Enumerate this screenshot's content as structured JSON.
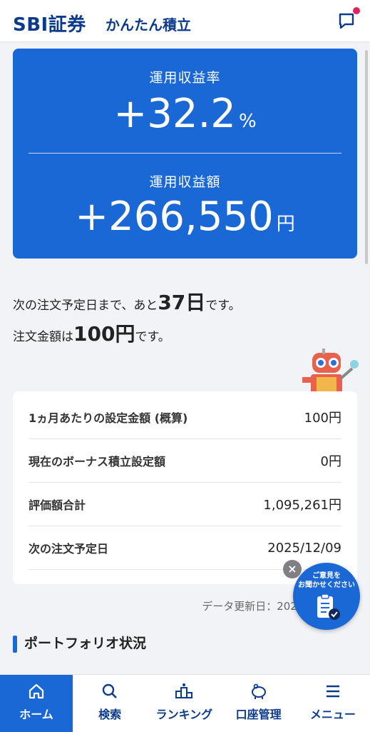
{
  "header": {
    "brand": "SBI証券",
    "app_name": "かんたん積立"
  },
  "summary": {
    "rate_label": "運用収益率",
    "rate_value": "+32.2",
    "rate_unit": "%",
    "amount_label": "運用収益額",
    "amount_value": "+266,550",
    "amount_unit": "円"
  },
  "info": {
    "line1_prefix": "次の注文予定日まで、あと",
    "days": "37日",
    "line1_suffix": "です。",
    "line2_prefix": "注文金額は",
    "amount": "100円",
    "line2_suffix": "です。"
  },
  "table": {
    "rows": [
      {
        "label": "1ヵ月あたりの設定金額 (概算)",
        "value": "100円"
      },
      {
        "label": "現在のボーナス積立設定額",
        "value": "0円"
      },
      {
        "label": "評価額合計",
        "value": "1,095,261円"
      },
      {
        "label": "次の注文予定日",
        "value": "2025/12/09"
      }
    ]
  },
  "updated": "データ更新日：2025/1",
  "feedback": {
    "line1": "ご意見を",
    "line2": "お聞かせください",
    "close": "×"
  },
  "section": {
    "title": "ポートフォリオ状況"
  },
  "nav": {
    "items": [
      {
        "label": "ホーム",
        "icon": "home-icon",
        "active": true
      },
      {
        "label": "検索",
        "icon": "search-icon",
        "active": false
      },
      {
        "label": "ランキング",
        "icon": "ranking-icon",
        "active": false
      },
      {
        "label": "口座管理",
        "icon": "piggy-bank-icon",
        "active": false
      },
      {
        "label": "メニュー",
        "icon": "menu-icon",
        "active": false
      }
    ]
  },
  "colors": {
    "primary": "#1a67d6",
    "navy": "#0c3b8c",
    "notification": "#e0245e"
  }
}
